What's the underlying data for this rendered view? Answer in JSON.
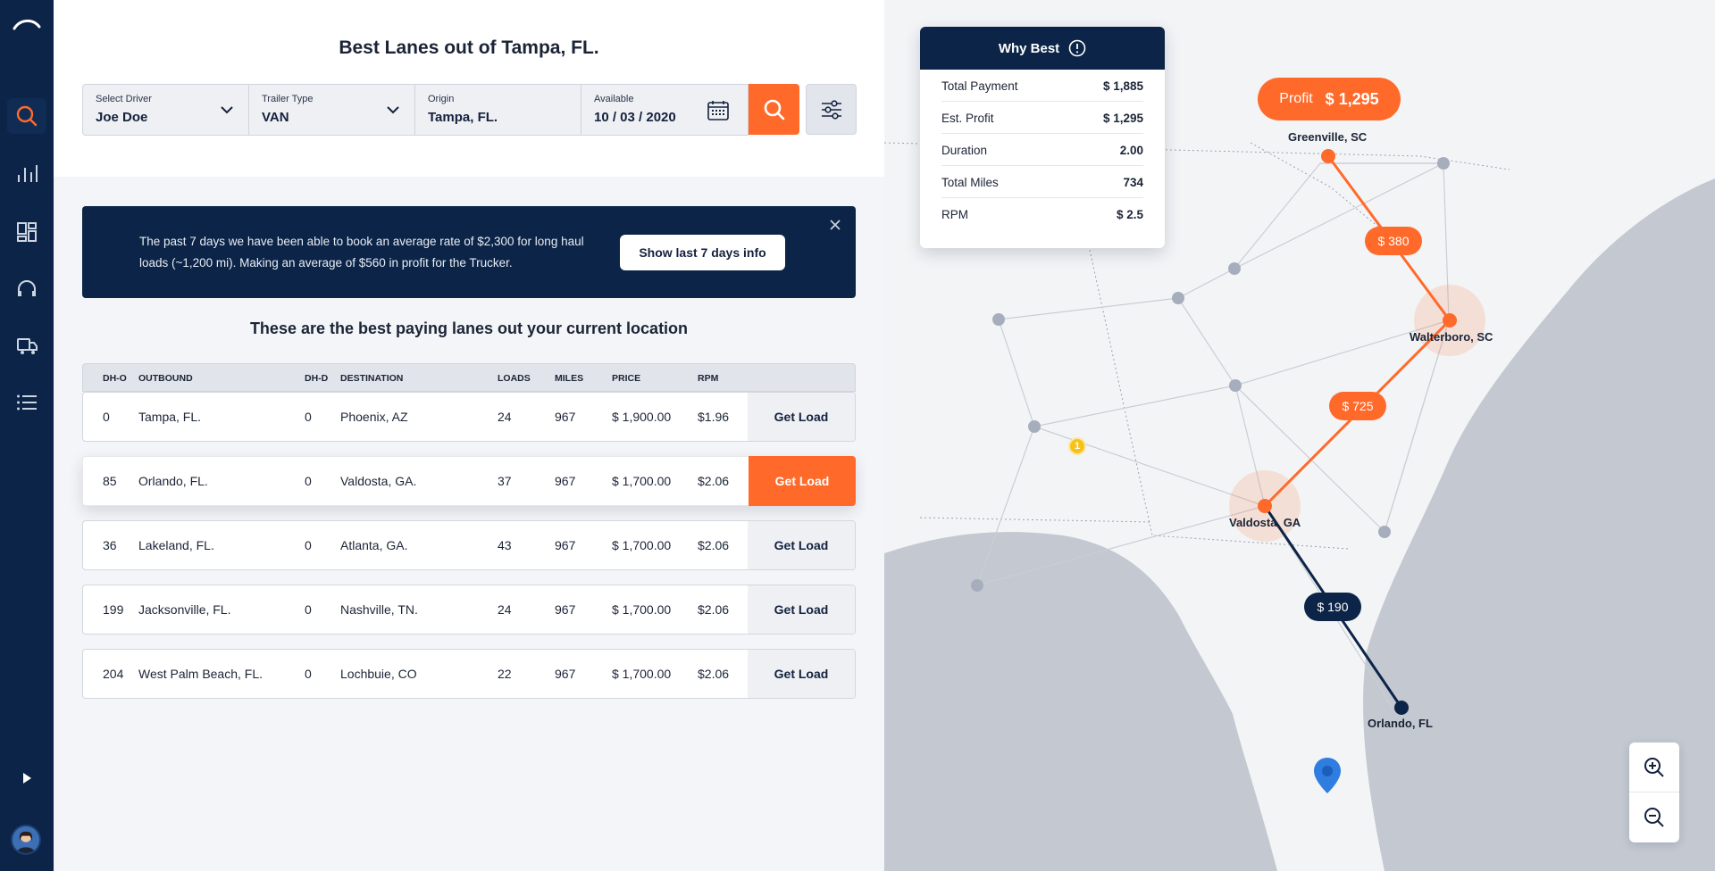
{
  "colors": {
    "navy": "#0b2447",
    "accent": "#ff6a2b",
    "dot": "#a6aebd"
  },
  "header": {
    "title_prefix": "Best Lanes out of",
    "title_city": "Tampa, FL."
  },
  "search": {
    "driver": {
      "label": "Select Driver",
      "value": "Joe Doe"
    },
    "trailer": {
      "label": "Trailer Type",
      "value": "VAN"
    },
    "origin": {
      "label": "Origin",
      "value": "Tampa, FL."
    },
    "available": {
      "label": "Available",
      "value": "10 / 03 / 2020"
    }
  },
  "banner": {
    "text": "The past 7 days we have been able to book an average rate of $2,300 for long haul loads (~1,200 mi). Making an average of $560 in profit for the Trucker.",
    "button": "Show last 7 days info"
  },
  "subtitle": "These are the best paying lanes out your current location",
  "table": {
    "columns": [
      "DH-O",
      "OUTBOUND",
      "DH-D",
      "DESTINATION",
      "LOADS",
      "MILES",
      "PRICE",
      "RPM"
    ],
    "action_label": "Get Load",
    "rows": [
      {
        "dho": "0",
        "outbound": "Tampa, FL.",
        "dhd": "0",
        "destination": "Phoenix, AZ",
        "loads": "24",
        "miles": "967",
        "price": "$ 1,900.00",
        "rpm": "$1.96"
      },
      {
        "dho": "85",
        "outbound": "Orlando, FL.",
        "dhd": "0",
        "destination": "Valdosta, GA.",
        "loads": "37",
        "miles": "967",
        "price": "$ 1,700.00",
        "rpm": "$2.06"
      },
      {
        "dho": "36",
        "outbound": "Lakeland, FL.",
        "dhd": "0",
        "destination": "Atlanta, GA.",
        "loads": "43",
        "miles": "967",
        "price": "$ 1,700.00",
        "rpm": "$2.06"
      },
      {
        "dho": "199",
        "outbound": "Jacksonville, FL.",
        "dhd": "0",
        "destination": "Nashville, TN.",
        "loads": "24",
        "miles": "967",
        "price": "$ 1,700.00",
        "rpm": "$2.06"
      },
      {
        "dho": "204",
        "outbound": "West Palm Beach, FL.",
        "dhd": "0",
        "destination": "Lochbuie, CO",
        "loads": "22",
        "miles": "967",
        "price": "$ 1,700.00",
        "rpm": "$2.06"
      }
    ]
  },
  "why_best": {
    "title": "Why Best",
    "items": [
      {
        "label": "Total Payment",
        "value": "$ 1,885"
      },
      {
        "label": "Est. Profit",
        "value": "$ 1,295"
      },
      {
        "label": "Duration",
        "value": "2.00"
      },
      {
        "label": "Total Miles",
        "value": "734"
      },
      {
        "label": "RPM",
        "value": "$ 2.5"
      }
    ]
  },
  "map": {
    "profit_label": "Profit",
    "profit_value": "$ 1,295",
    "segments": [
      "$ 380",
      "$ 725",
      "$ 190"
    ],
    "cities": [
      "Greenville, SC",
      "Walterboro, SC",
      "Valdosta, GA",
      "Orlando, FL"
    ],
    "cluster_count": "1"
  },
  "icons": {
    "sidebar": [
      "logo-icon",
      "search-icon",
      "chart-icon",
      "dashboard-icon",
      "headset-icon",
      "truck-icon",
      "list-icon",
      "play-icon"
    ],
    "other": [
      "chevron-down-icon",
      "calendar-icon",
      "filter-icon",
      "close-icon",
      "info-icon",
      "zoom-in-icon",
      "zoom-out-icon",
      "location-pin-icon"
    ]
  }
}
